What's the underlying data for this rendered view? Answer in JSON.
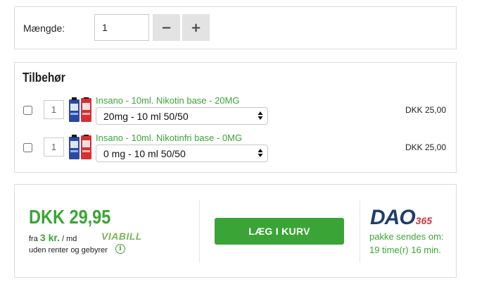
{
  "quantity": {
    "label": "Mængde:",
    "value": "1",
    "minus_label": "−",
    "plus_label": "+"
  },
  "accessories": {
    "title": "Tilbehør",
    "items": [
      {
        "qty": "1",
        "name": "Insano - 10ml. Nikotin base - 20MG",
        "selected_option": "20mg - 10 ml 50/50",
        "price": "DKK 25,00",
        "checked": false
      },
      {
        "qty": "1",
        "name": "Insano - 10ml. Nikotinfri base - 0MG",
        "selected_option": "0 mg - 10 ml 50/50",
        "price": "DKK 25,00",
        "checked": false
      }
    ]
  },
  "buy": {
    "price": "DKK 29,95",
    "finance_prefix": "fra",
    "finance_amount": "3 kr.",
    "finance_suffix": "/ md",
    "finance_provider": "VIABILL",
    "finance_note": "uden renter og gebyrer",
    "info_glyph": "i",
    "add_to_cart_label": "LÆG I KURV",
    "shop_logo_text": "DAO",
    "shop_logo_number": "365",
    "shipping_line1": "pakke sendes om:",
    "shipping_line2": "19 time(r) 16 min."
  },
  "icons": {
    "minus": "minus-icon",
    "plus": "plus-icon",
    "select_arrows": "updown-arrows-icon",
    "info": "info-icon",
    "product": "bottle-pack-icon"
  },
  "colors": {
    "accent_green": "#3aa536",
    "button_gray": "#e3e3e3",
    "border": "#dcdcdc",
    "logo_blue": "#1e3d6e",
    "logo_red": "#d8343a"
  }
}
